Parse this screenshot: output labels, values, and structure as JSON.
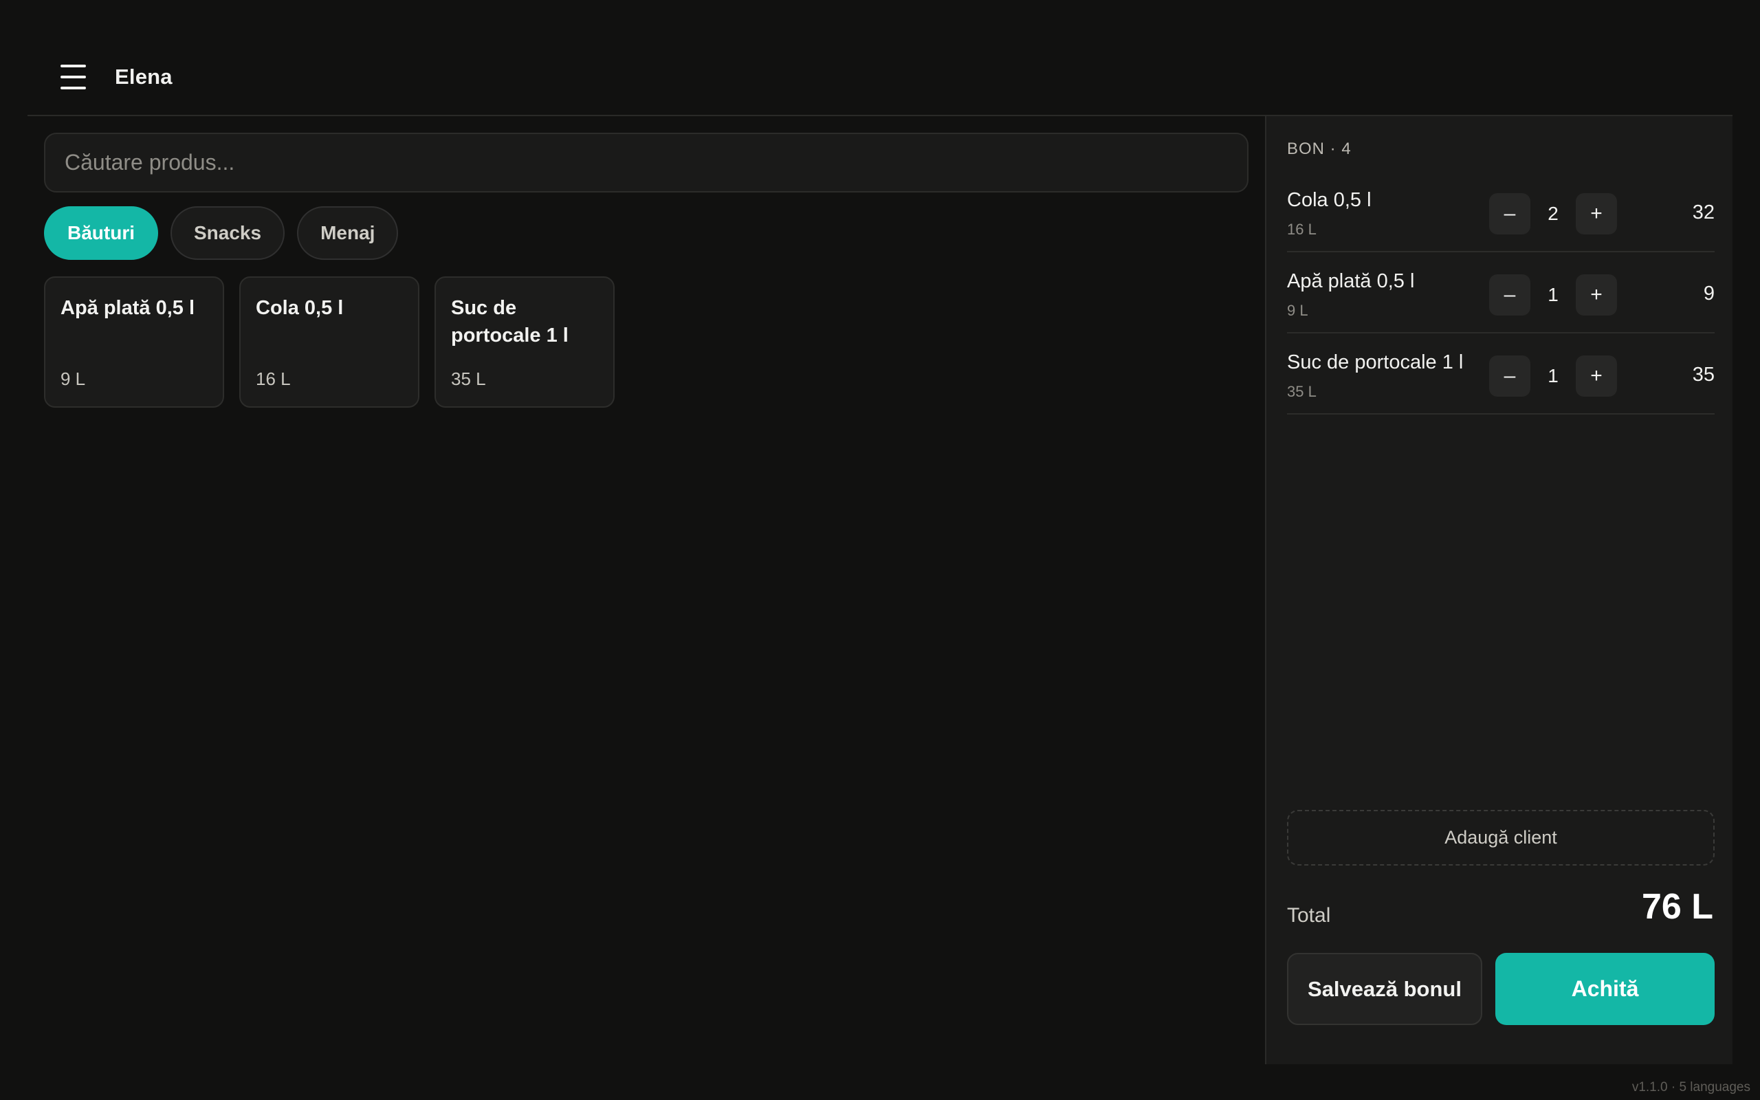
{
  "header": {
    "user_name": "Elena",
    "menu_icon": "hamburger-menu-icon"
  },
  "search": {
    "placeholder": "Căutare produs...",
    "value": ""
  },
  "categories": [
    {
      "label": "Băuturi",
      "active": true
    },
    {
      "label": "Snacks",
      "active": false
    },
    {
      "label": "Menaj",
      "active": false
    }
  ],
  "products": [
    {
      "name": "Apă plată 0,5 l",
      "price": "9 L"
    },
    {
      "name": "Cola 0,5 l",
      "price": "16 L"
    },
    {
      "name": "Suc de portocale 1 l",
      "price": "35 L"
    }
  ],
  "receipt": {
    "title": "BON · 4",
    "lines": [
      {
        "name": "Cola 0,5 l",
        "unit_price": "16 L",
        "qty": "2",
        "total": "32"
      },
      {
        "name": "Apă plată 0,5 l",
        "unit_price": "9 L",
        "qty": "1",
        "total": "9"
      },
      {
        "name": "Suc de portocale 1 l",
        "unit_price": "35 L",
        "qty": "1",
        "total": "35"
      }
    ],
    "minus_symbol": "–",
    "plus_symbol": "+",
    "add_client_label": "Adaugă client",
    "total_label": "Total",
    "total_value": "76 L",
    "save_label": "Salvează bonul",
    "pay_label": "Achită"
  },
  "footer": {
    "version": "v1.1.0 · 5 languages"
  },
  "colors": {
    "accent": "#14b7a6",
    "background": "#111110",
    "panel": "#1a1a19"
  }
}
